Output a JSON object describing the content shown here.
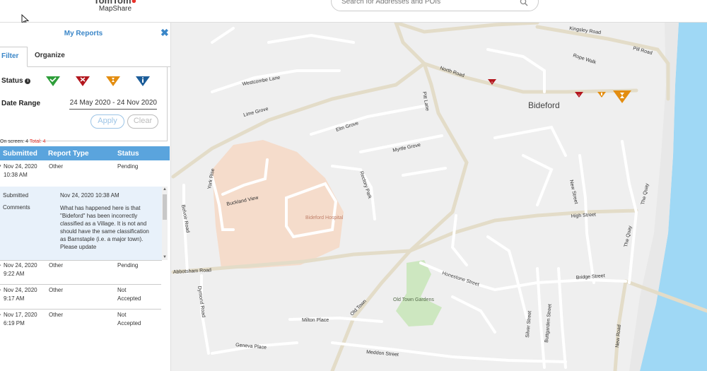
{
  "header": {
    "brand_sub": "MapShare",
    "search_placeholder": "Search for Addresses and POIs",
    "icons": {
      "search": "search-icon",
      "cursor": "cursor-pointer-icon"
    }
  },
  "panel": {
    "title": "My Reports",
    "close_icon": "close-icon",
    "tabs": [
      "Filter",
      "Organize"
    ],
    "status_label": "Status",
    "status_info_icon": "info-icon",
    "status_icons": [
      {
        "name": "accepted-status-icon",
        "color": "#2e9e3a",
        "glyph": "check"
      },
      {
        "name": "not-accepted-status-icon",
        "color": "#b3161d",
        "glyph": "x"
      },
      {
        "name": "pending-status-icon",
        "color": "#e38d10",
        "glyph": "hourglass"
      },
      {
        "name": "info-status-icon",
        "color": "#1c5d99",
        "glyph": "info"
      }
    ],
    "date_range_label": "Date Range",
    "date_range_value": "24 May 2020 - 24 Nov 2020",
    "apply_label": "Apply",
    "clear_label": "Clear",
    "on_screen_label": "On screen: 4",
    "total_label": "Total: 4",
    "columns": [
      "Submitted",
      "Report Type",
      "Status"
    ],
    "rows": [
      {
        "date": "Nov 24, 2020",
        "time": "10:38 AM",
        "type": "Other",
        "status": "Pending",
        "status2": ""
      },
      {
        "date": "Nov 24, 2020",
        "time": "9:22 AM",
        "type": "Other",
        "status": "Pending",
        "status2": ""
      },
      {
        "date": "Nov 24, 2020",
        "time": "9:17 AM",
        "type": "Other",
        "status": "Not",
        "status2": "Accepted"
      },
      {
        "date": "Nov 17, 2020",
        "time": "6:19 PM",
        "type": "Other",
        "status": "Not",
        "status2": "Accepted"
      }
    ],
    "detail": {
      "submitted_label": "Submitted",
      "submitted_value": "Nov 24, 2020 10:38 AM",
      "comments_label": "Comments",
      "comments_value": "What has happened here is that \"Bideford\" has been incorrectly classified as a Village. It is not and should have the same classification as Barnstaple (i.e. a major town). Please update"
    }
  },
  "map": {
    "colors": {
      "land": "#efefef",
      "road": "#ffffff",
      "major_road": "#e3dcc8",
      "water": "#9fd8f5",
      "park": "#cde7c0",
      "hospital": "#f5dccb",
      "marker_red": "#b3161d",
      "marker_orange": "#e38d10"
    },
    "city_label": "Bideford",
    "hospital_label": "Bideford Hospital",
    "park_label": "Old Town Gardens",
    "streets": [
      "Kingsley Road",
      "Pill Road",
      "Rope Walk",
      "North Road",
      "Westcombe Lane",
      "Lime Grove",
      "Elm Grove",
      "Myrtle Grove",
      "Pitt Lane",
      "Rectory Park",
      "York Rise",
      "Buckland View",
      "Belvoir Road",
      "New Street",
      "The Quay",
      "The Quay",
      "High Street",
      "Bridge Street",
      "Honestone Street",
      "Abbotsham Road",
      "Dymond Road",
      "Old Town",
      "Milton Place",
      "Geneva Place",
      "Meddon Street",
      "Silver Street",
      "Buttgarden Street",
      "New Road"
    ]
  }
}
